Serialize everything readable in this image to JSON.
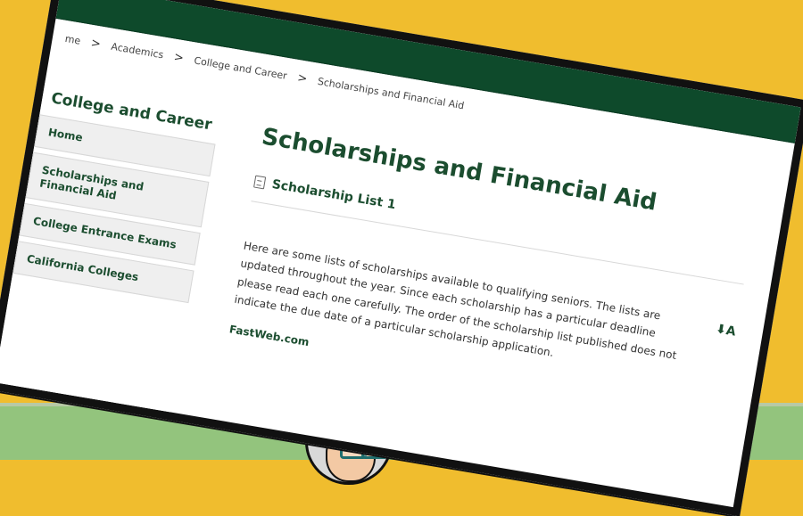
{
  "breadcrumb": {
    "items": [
      "me",
      "Academics",
      "College and Career",
      "Scholarships and Financial Aid"
    ],
    "separator": ">"
  },
  "sidebar": {
    "title": "College and Career",
    "items": [
      {
        "label": "Home"
      },
      {
        "label": "Scholarships and Financial Aid"
      },
      {
        "label": "College Entrance Exams"
      },
      {
        "label": "California Colleges"
      }
    ]
  },
  "main": {
    "heading": "Scholarships and Financial Aid",
    "link_label": "Scholarship List 1",
    "description": "Here are some lists of scholarships available to qualifying seniors. The lists are updated throughout the year. Since each scholarship has a particular deadline please read each one carefully. The order of the scholarship list published does not indicate the due date of a particular scholarship application.",
    "resource_link": "FastWeb.com",
    "translate_icon": "translate-icon"
  },
  "colors": {
    "brand_green": "#0e4a2b",
    "text_green": "#1b4d2f",
    "background_yellow": "#f0bd2e",
    "band_green": "#93c47d"
  }
}
